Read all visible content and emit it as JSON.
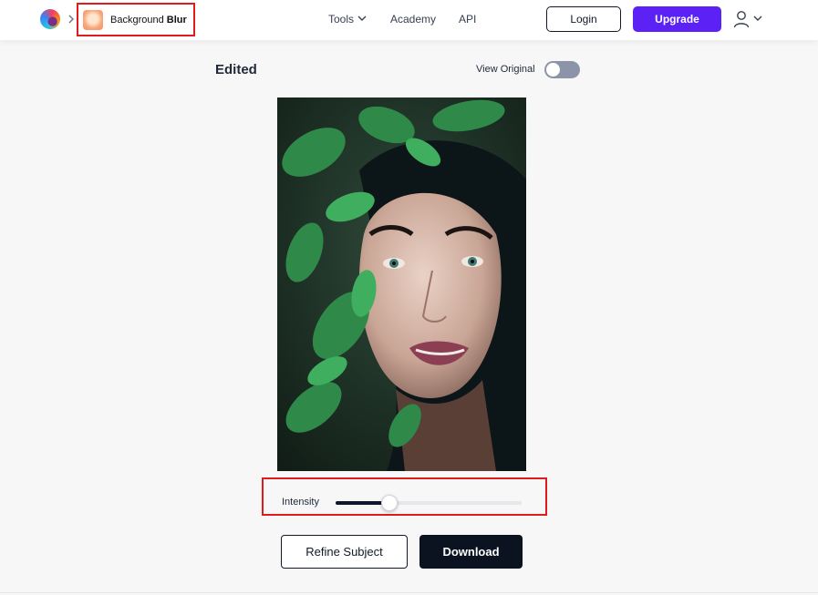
{
  "header": {
    "brand_icon": "brand-logo",
    "breadcrumb_chevron_icon": "chevron-right-icon",
    "tool": {
      "icon": "background-blur-icon",
      "name_prefix": "Background",
      "name_bold": "Blur"
    },
    "nav": {
      "tools": "Tools",
      "academy": "Academy",
      "api": "API"
    },
    "login_label": "Login",
    "upgrade_label": "Upgrade",
    "user_icon": "user-icon"
  },
  "main": {
    "title": "Edited",
    "view_original_label": "View Original",
    "view_original_on": false,
    "image": "portrait-photo",
    "intensity": {
      "label": "Intensity",
      "value_fraction": 0.29
    },
    "refine_label": "Refine Subject",
    "download_label": "Download"
  },
  "colors": {
    "accent": "#5b21f5",
    "dark_button": "#0b1220",
    "highlight": "#e01b1b",
    "toggle_off": "#8b95a7"
  }
}
